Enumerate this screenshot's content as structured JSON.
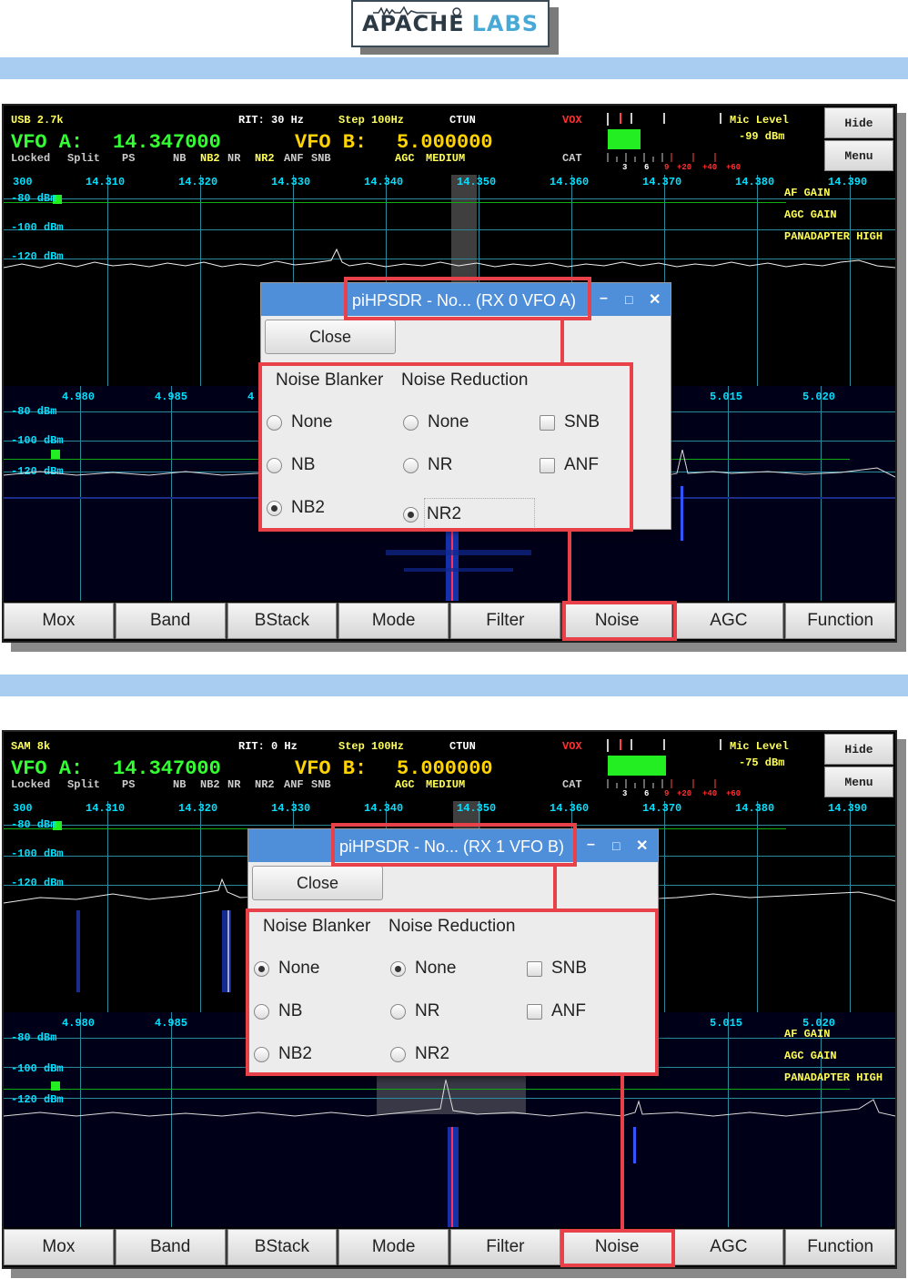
{
  "logo": {
    "text_a": "APACHE",
    "text_b": "LABS"
  },
  "screens": [
    {
      "mode": "USB 2.7k",
      "rit": "RIT: 30 Hz",
      "step": "Step 100Hz",
      "ctun": "CTUN",
      "vox": "VOX",
      "mic_label": "Mic Level",
      "mic_value": "-99 dBm",
      "vfo_a_label": "VFO A:",
      "vfo_a_freq": "14.347000",
      "vfo_b_label": "VFO B:",
      "vfo_b_freq": "5.000000",
      "status": [
        "Locked",
        "Split",
        "PS",
        "NB",
        "NB2",
        "NR",
        "NR2",
        "ANF",
        "SNB",
        "AGC",
        "MEDIUM",
        "CAT"
      ],
      "meter_scale": [
        "3",
        "6",
        "9",
        "+20",
        "+40",
        "+60"
      ],
      "freq_top": [
        "300",
        "14.310",
        "14.320",
        "14.330",
        "14.340",
        "14.350",
        "14.360",
        "14.370",
        "14.380",
        "14.390"
      ],
      "db_top": [
        "-80 dBm",
        "-100 dBm",
        "-120 dBm"
      ],
      "right_labels": [
        "AF GAIN",
        "AGC GAIN",
        "PANADAPTER HIGH"
      ],
      "freq_bottom": [
        "4.980",
        "4.985",
        "4",
        "5.015",
        "5.020"
      ],
      "db_bottom": [
        "-80 dBm",
        "-100 dBm",
        "-120 dBm"
      ],
      "dialog_title": "piHPSDR - No... (RX 0 VFO A)",
      "nb_selected": "NB2",
      "nr_selected": "NR2"
    },
    {
      "mode": "SAM 8k",
      "rit": "RIT: 0 Hz",
      "step": "Step 100Hz",
      "ctun": "CTUN",
      "vox": "VOX",
      "mic_label": "Mic Level",
      "mic_value": "-75 dBm",
      "vfo_a_label": "VFO A:",
      "vfo_a_freq": "14.347000",
      "vfo_b_label": "VFO B:",
      "vfo_b_freq": "5.000000",
      "status": [
        "Locked",
        "Split",
        "PS",
        "NB",
        "NB2",
        "NR",
        "NR2",
        "ANF",
        "SNB",
        "AGC",
        "MEDIUM",
        "CAT"
      ],
      "meter_scale": [
        "3",
        "6",
        "9",
        "+20",
        "+40",
        "+60"
      ],
      "freq_top": [
        "300",
        "14.310",
        "14.320",
        "14.330",
        "14.340",
        "14.350",
        "14.360",
        "14.370",
        "14.380",
        "14.390"
      ],
      "db_top": [
        "-80 dBm",
        "-100 dBm",
        "-120 dBm"
      ],
      "right_labels": [
        "AF GAIN",
        "AGC GAIN",
        "PANADAPTER HIGH"
      ],
      "freq_bottom": [
        "4.980",
        "4.985",
        "5.015",
        "5.020"
      ],
      "db_bottom": [
        "-80 dBm",
        "-100 dBm",
        "-120 dBm"
      ],
      "dialog_title": "piHPSDR - No... (RX 1 VFO B)",
      "nb_selected": "None",
      "nr_selected": "None"
    }
  ],
  "side_buttons": {
    "hide": "Hide",
    "menu": "Menu"
  },
  "bottom_buttons": [
    "Mox",
    "Band",
    "BStack",
    "Mode",
    "Filter",
    "Noise",
    "AGC",
    "Function"
  ],
  "dialog": {
    "close": "Close",
    "nb_header": "Noise Blanker",
    "nr_header": "Noise Reduction",
    "nb_options": [
      "None",
      "NB",
      "NB2"
    ],
    "nr_options": [
      "None",
      "NR",
      "NR2"
    ],
    "checks": [
      "SNB",
      "ANF"
    ],
    "min_icon": "–",
    "max_icon": "□",
    "close_icon": "✕"
  },
  "colors": {
    "highlight": "#e8414a",
    "titlebar": "#4f8fd9",
    "bluebar": "#a9ccf1"
  }
}
